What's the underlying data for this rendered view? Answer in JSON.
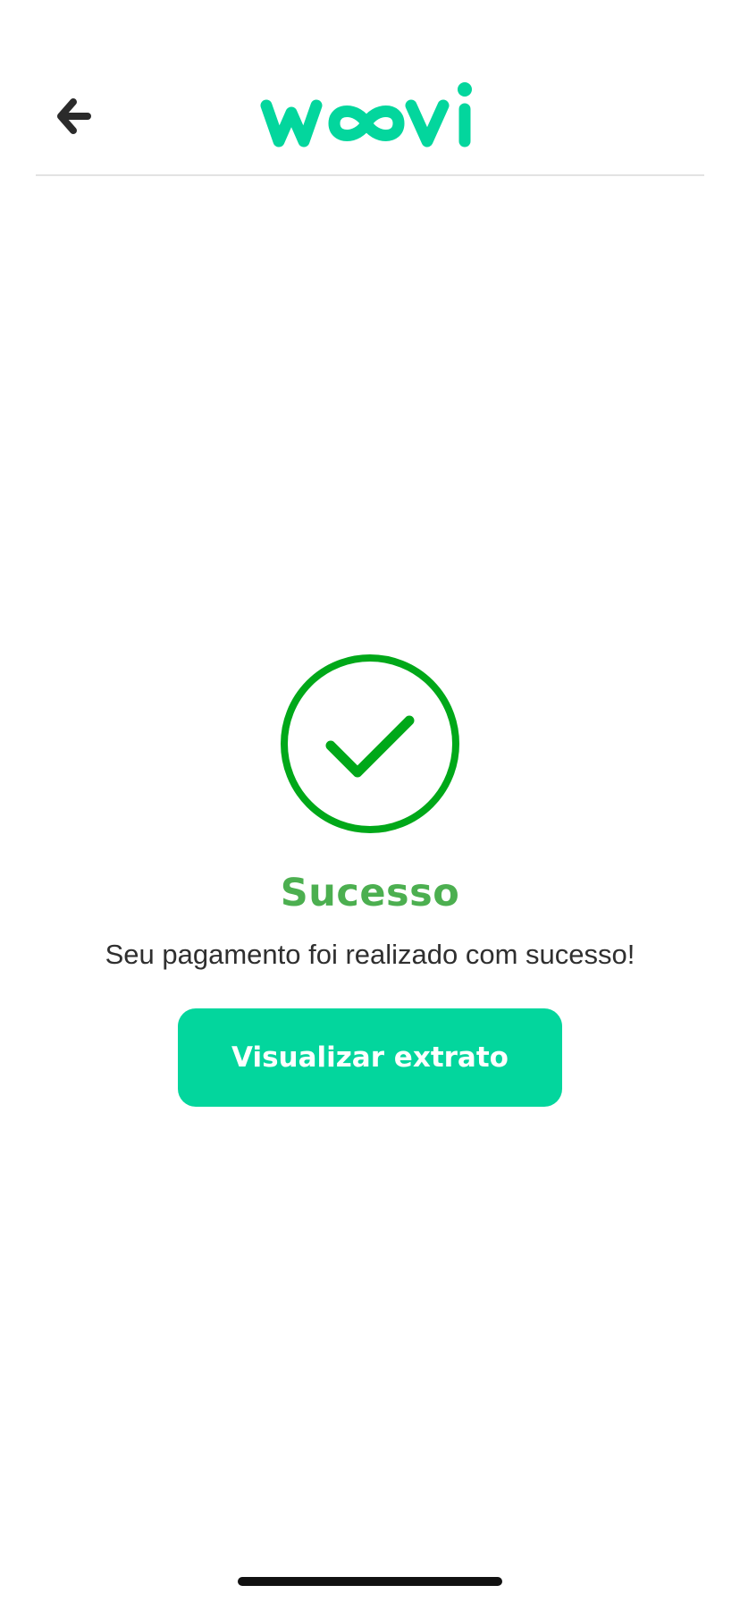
{
  "header": {
    "back_icon": "arrow-left-icon",
    "logo_text": "woovi",
    "logo_color": "#03d69d"
  },
  "result": {
    "icon": "check-circle-icon",
    "icon_color": "#00a819",
    "title": "Sucesso",
    "title_color": "#4caf50",
    "message": "Seu pagamento foi realizado com sucesso!"
  },
  "actions": {
    "view_statement_label": "Visualizar extrato",
    "button_color": "#03d69d"
  }
}
